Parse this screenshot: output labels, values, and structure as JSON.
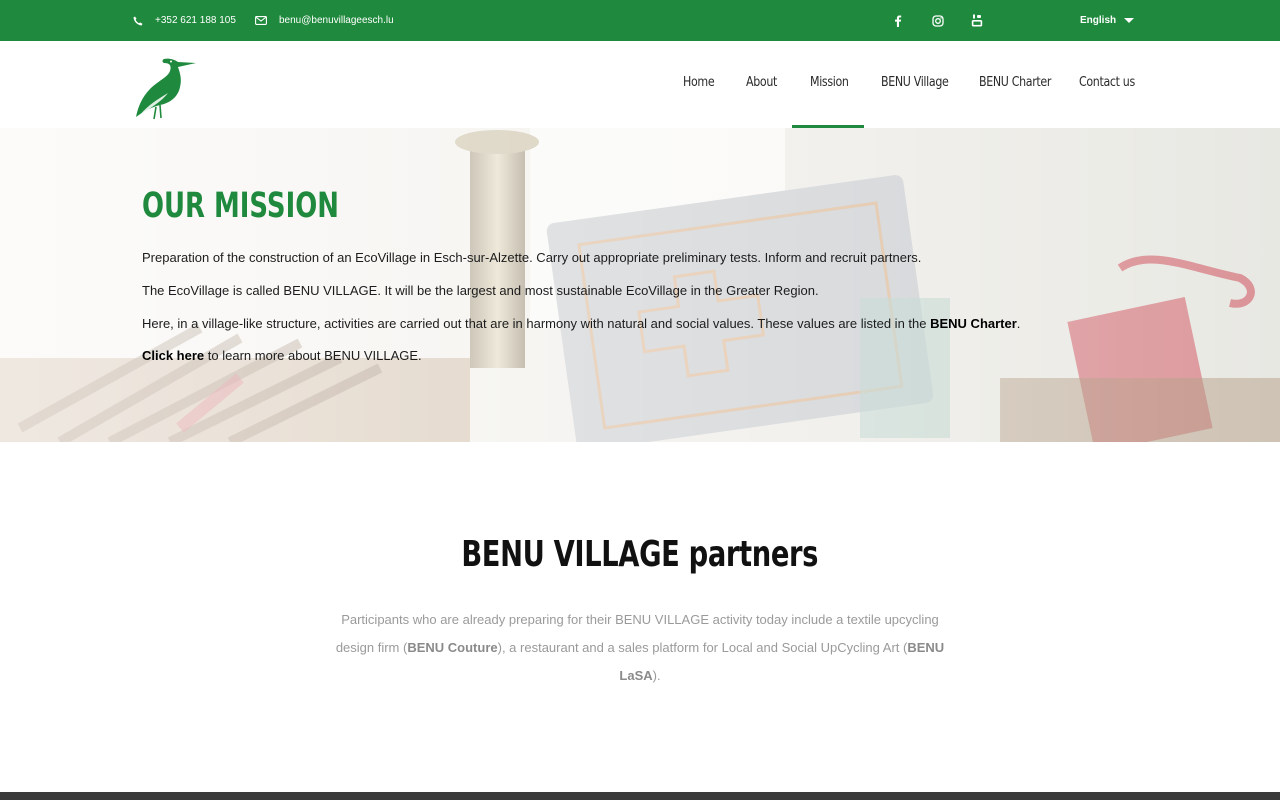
{
  "topbar": {
    "phone": "+352 621 188 105",
    "email": "benu@benuvillageesch.lu",
    "social": [
      "facebook-icon",
      "instagram-icon",
      "youtube-icon"
    ],
    "language": "English",
    "bg_color": "#1f8a3d"
  },
  "brand": {
    "logo": "heron-logo",
    "accent_color": "#1f8a3d"
  },
  "nav": {
    "items": [
      {
        "label": "Home"
      },
      {
        "label": "About"
      },
      {
        "label": "Mission",
        "active": true
      },
      {
        "label": "BENU Village"
      },
      {
        "label": "BENU Charter"
      },
      {
        "label": "Contact us"
      }
    ]
  },
  "hero": {
    "title": "OUR MISSION",
    "p1": "Preparation of the construction of an EcoVillage in Esch-sur-Alzette. Carry out appropriate preliminary tests. Inform and recruit partners.",
    "p2": "The EcoVillage is called BENU VILLAGE. It will be the largest and most sustainable EcoVillage in the Greater Region.",
    "p3_text": "Here, in a village-like structure, activities are carried out that are in harmony with natural and social values. These values are listed in the",
    "p3_link": "BENU Charter",
    "p3_end": ".",
    "p4_link": "Click here",
    "p4_text": "to learn more about BENU VILLAGE."
  },
  "partners": {
    "title": "BENU VILLAGE partners",
    "text_a": "Participants who are already preparing for their BENU VILLAGE activity today include a textile upcycling design firm (",
    "brand1": "BENU Couture",
    "text_b": "), a restaurant and a sales platform for Local and Social UpCycling Art (",
    "brand2": "BENU LaSA",
    "text_c": ")."
  }
}
